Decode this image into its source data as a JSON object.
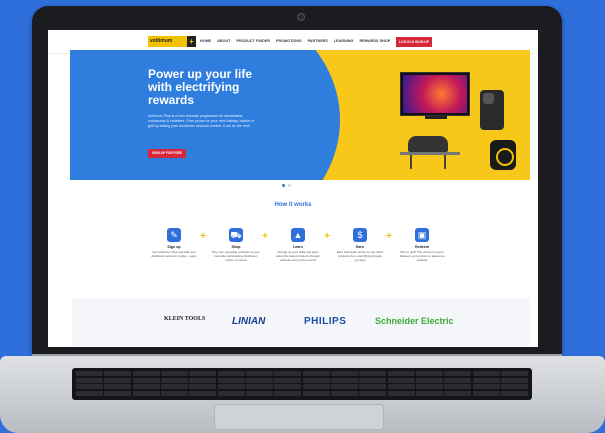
{
  "nav": {
    "logo_text": "voltimum",
    "logo_plus": "+",
    "items": [
      "HOME",
      "ABOUT",
      "PRODUCT FINDER",
      "PROMOTIONS",
      "PARTNERS",
      "LEARNING",
      "REWARDS SHOP"
    ],
    "login_label": "LOG IN & SIGN UP"
  },
  "hero": {
    "title": "Power up your life with electrifying rewards",
    "text": "Voltimum Plus is a new rewards programme for electricians, contractors & installers. Earn points for your next holiday, basket or grill by adding your distributor account number & we do the rest!",
    "button_label": "SIGN UP FOR FREE"
  },
  "how": {
    "title": "How it works",
    "steps": [
      {
        "title": "Sign up",
        "desc": "Join Voltimum Plus and add your distributor account number - easy!"
      },
      {
        "title": "Shop",
        "desc": "Buy your everyday products at your favourite participating distributor, online or instore"
      },
      {
        "title": "Learn",
        "desc": "Charge up your skills and learn about the latest products through webinars and online events"
      },
      {
        "title": "Earn",
        "desc": "Earn automatic points on top-notch products from electrifying brands you love"
      },
      {
        "title": "Redeem",
        "desc": "Drill or grill? The choice is yours! Redeem your points for awesome rewards"
      }
    ],
    "separator": "+"
  },
  "brands": [
    "KLEIN TOOLS",
    "LINIAN",
    "PHILIPS",
    "Schneider Electric"
  ],
  "colors": {
    "primary": "#2f7ddc",
    "accent": "#f7c719",
    "cta": "#d6283a"
  }
}
